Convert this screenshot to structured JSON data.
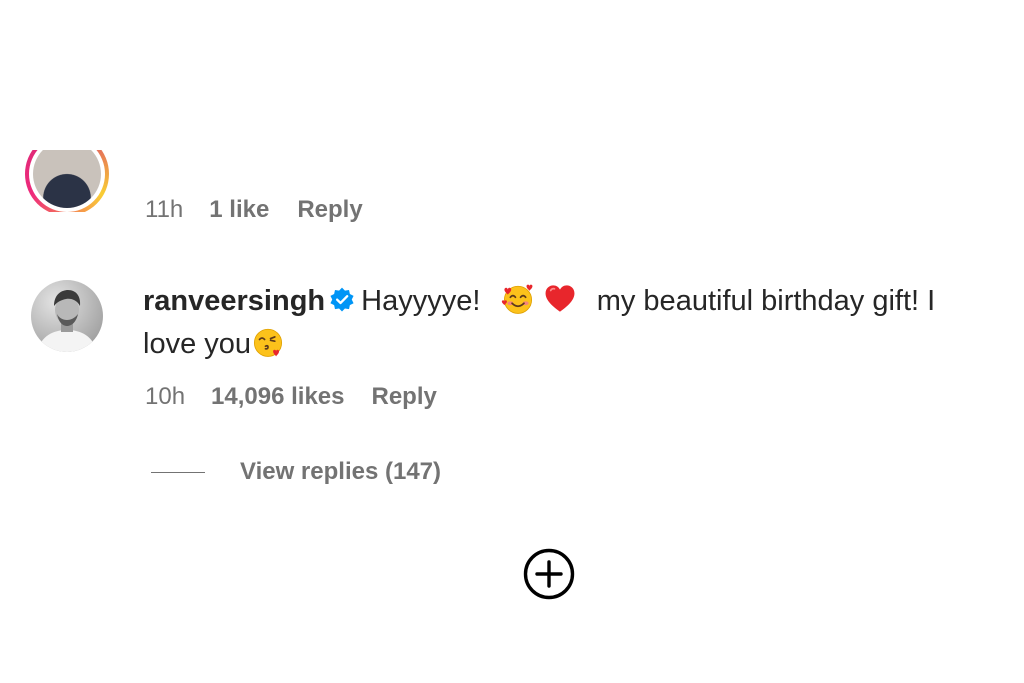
{
  "previous_comment": {
    "time": "11h",
    "likes": "1 like",
    "reply_label": "Reply"
  },
  "comment": {
    "username": "ranveersingh",
    "text_part1": "Hayyyye!",
    "text_part2": "my beautiful birthday gift! I love you",
    "emojis": [
      "smiling-face-with-hearts-icon",
      "red-heart-icon",
      "face-blowing-a-kiss-icon"
    ],
    "time": "10h",
    "likes": "14,096 likes",
    "reply_label": "Reply",
    "view_replies_label": "View replies (147)"
  },
  "colors": {
    "text_primary": "#262626",
    "text_secondary": "#737373",
    "verified_blue": "#0095f6",
    "background": "#ffffff"
  },
  "icons": {
    "verified": "verified-badge-icon",
    "load_more": "plus-circle-icon"
  }
}
